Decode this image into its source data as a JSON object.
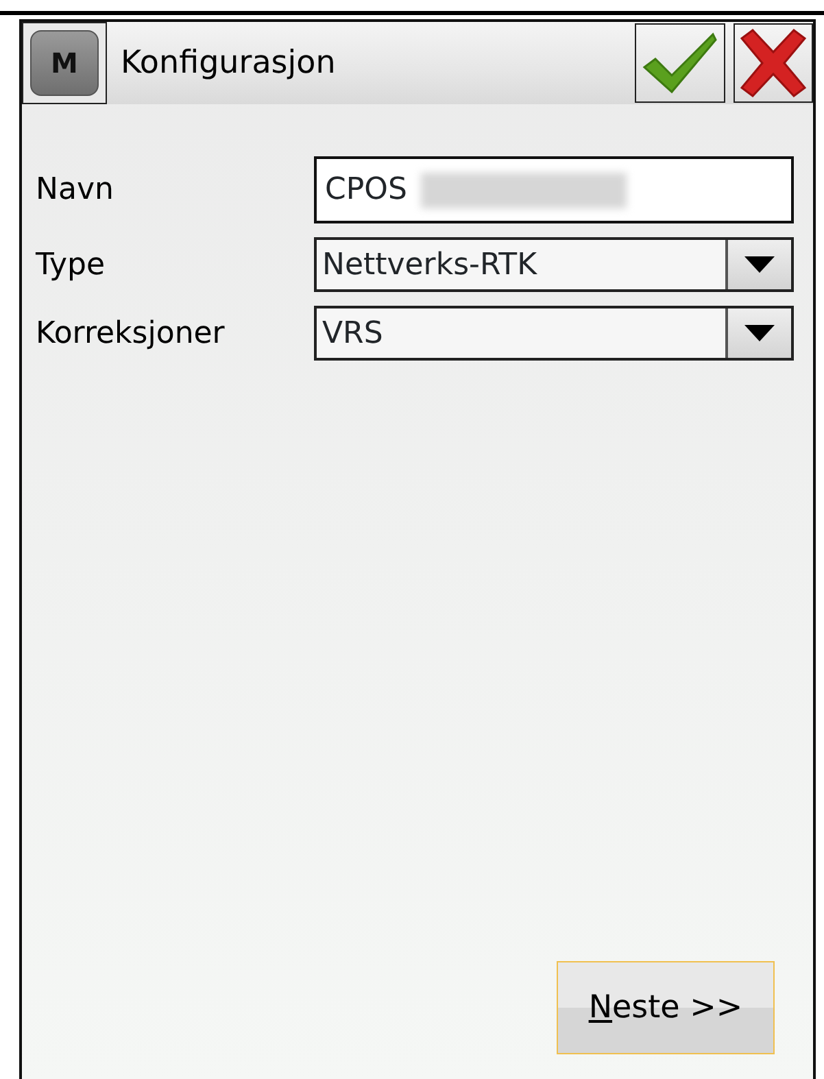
{
  "window": {
    "title": "Konfigurasjon",
    "menu_button": "M"
  },
  "fields": [
    {
      "kind": "text",
      "label": "Navn",
      "value": "CPOS",
      "redacted": true
    },
    {
      "kind": "dropdown",
      "label": "Type",
      "value": "Nettverks-RTK"
    },
    {
      "kind": "dropdown",
      "label": "Korreksjoner",
      "value": "VRS"
    }
  ],
  "next_button": {
    "label": "Neste >>",
    "first_letter_underlined": true
  }
}
